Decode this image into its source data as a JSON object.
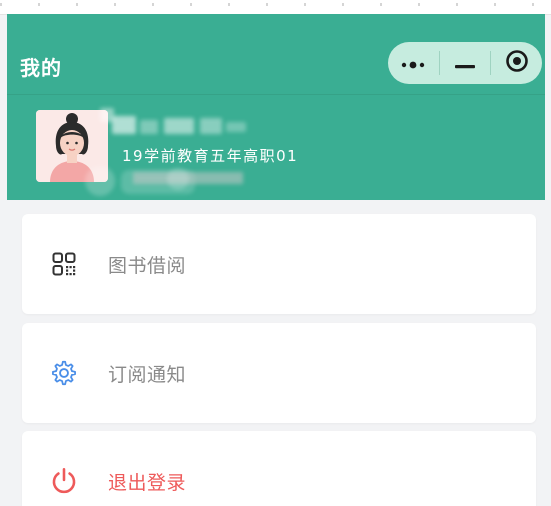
{
  "nav": {
    "title": "我的",
    "capsule": {
      "more_icon": "more-dots-icon",
      "minimize_icon": "minimize-icon",
      "close_icon": "target-close-icon"
    }
  },
  "profile": {
    "avatar_icon": "female-avatar-icon",
    "class_name": "19学前教育五年高职01"
  },
  "menu": [
    {
      "label": "图书借阅",
      "icon": "qrcode-icon"
    },
    {
      "label": "订阅通知",
      "icon": "gear-icon"
    },
    {
      "label": "退出登录",
      "icon": "power-icon"
    }
  ],
  "colors": {
    "header": "#3aae93",
    "capsule": "#c6ecdf",
    "gear": "#4a8ee8",
    "logout": "#ee5a5a"
  }
}
